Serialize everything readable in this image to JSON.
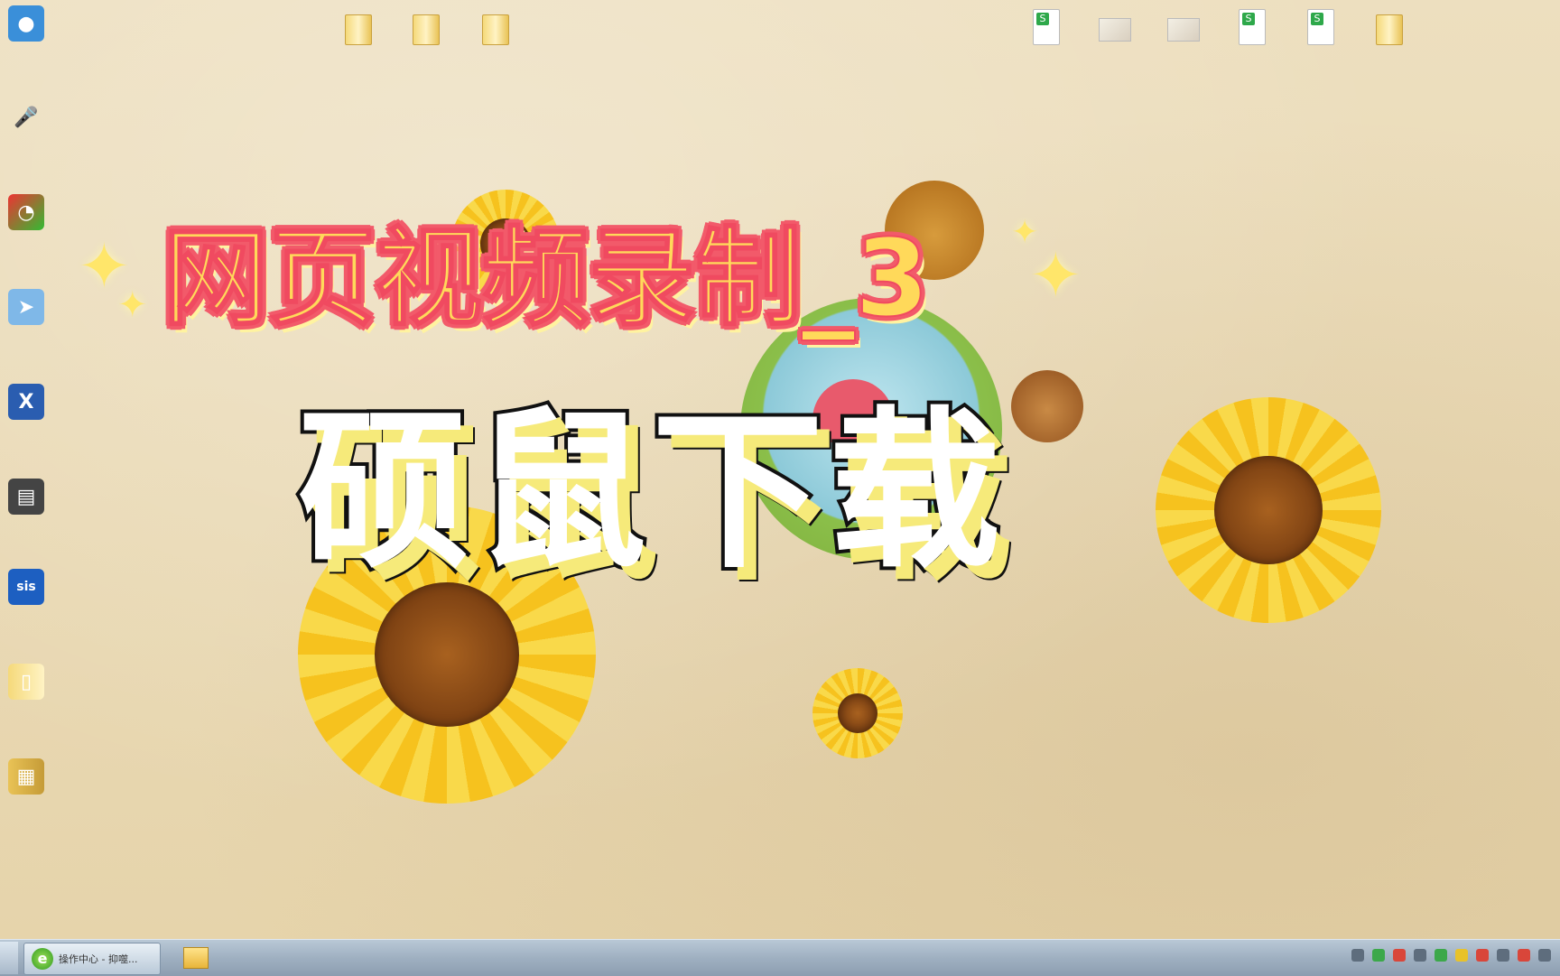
{
  "overlay": {
    "title_line1": "网页视频录制_3",
    "title_line2": "硕鼠下载"
  },
  "taskbar": {
    "active_task_label": "操作中心 - 抑噬..."
  },
  "colors": {
    "title_line1_fill": "#ffd95a",
    "title_line1_outline": "#f25a6a",
    "title_line2_fill": "#ffffff",
    "desktop_background": "#e9d9b4"
  },
  "icons": {
    "left_column": [
      "webcam-app-icon",
      "microphone-client-icon",
      "gauge-app-icon",
      "pointer-tool-icon",
      "xshell-icon",
      "ssd-tool-icon",
      "sis-icon",
      "document-folder-icon",
      "folder-icon"
    ],
    "top_row": [
      "folder-shortcut-icon",
      "folder-shortcut-icon",
      "folder-icon",
      "spreadsheet-icon",
      "image-file-icon",
      "image-file-icon",
      "spreadsheet-icon",
      "spreadsheet-icon",
      "folder-icon"
    ],
    "taskbar": [
      "start-button-icon",
      "ie-icon",
      "file-manager-icon"
    ]
  }
}
